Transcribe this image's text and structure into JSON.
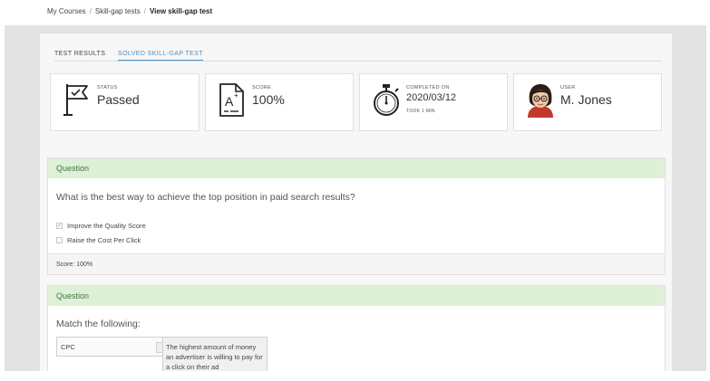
{
  "breadcrumb": {
    "item1": "My Courses",
    "item2": "Skill-gap tests",
    "current": "View skill-gap test",
    "separator": "/"
  },
  "tabs": {
    "tab1": "TEST RESULTS",
    "tab2": "SOLVED SKILL-GAP TEST"
  },
  "cards": {
    "status": {
      "label": "STATUS",
      "value": "Passed",
      "icon": "flag-icon"
    },
    "score": {
      "label": "SCORE",
      "value": "100%",
      "icon": "grade-document-icon"
    },
    "completed": {
      "label": "COMPLETED ON",
      "value": "2020/03/12",
      "sub": "TOOK 1 MIN",
      "icon": "stopwatch-icon"
    },
    "user": {
      "label": "USER",
      "value": "M. Jones",
      "icon": "avatar"
    }
  },
  "question1": {
    "header": "Question",
    "text": "What is the best way to achieve the top position in paid search results?",
    "options": [
      {
        "label": "Improve the Quality Score",
        "checked": true
      },
      {
        "label": "Raise the Cost Per Click",
        "checked": false
      }
    ],
    "score": "Score: 100%"
  },
  "question2": {
    "header": "Question",
    "text": "Match the following:",
    "term": "CPC",
    "definition": "The highest amount of money an advertiser is willing to pay for a click on their ad"
  },
  "colors": {
    "accent": "#4a90c8",
    "header_bg": "#dff0d8",
    "header_text": "#3c763d"
  }
}
